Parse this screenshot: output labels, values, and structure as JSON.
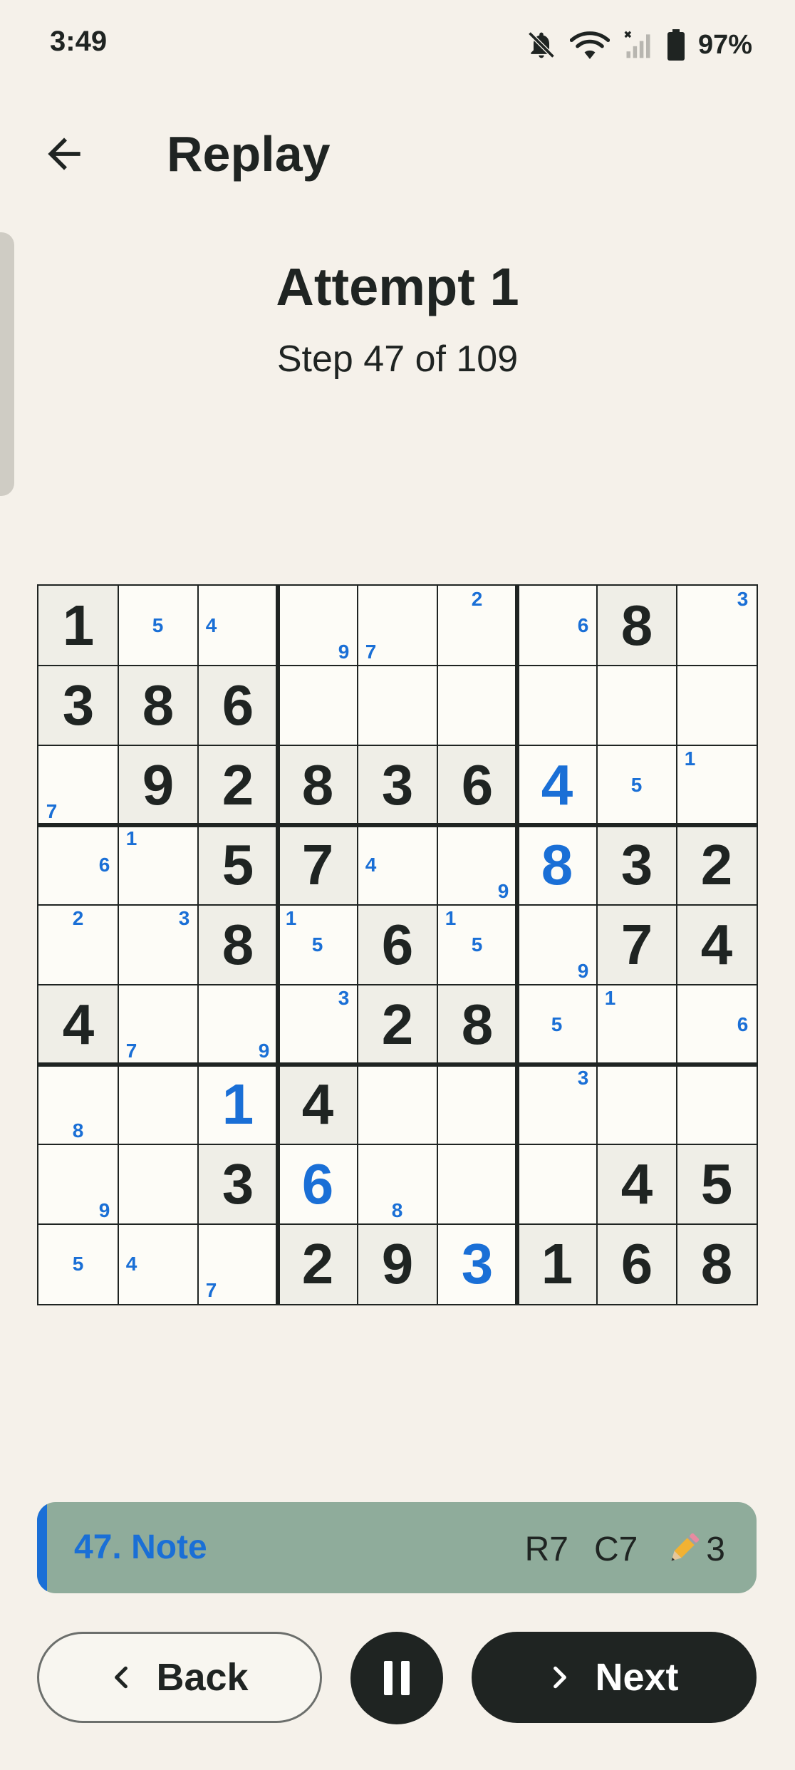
{
  "status_bar": {
    "time": "3:49",
    "battery": "97%",
    "icons": [
      "bell-off-icon",
      "wifi-icon",
      "signal-off-icon",
      "battery-icon"
    ]
  },
  "header": {
    "title": "Replay",
    "back_icon": "arrow-left-icon"
  },
  "replay": {
    "attempt": "Attempt 1",
    "step": "Step 47 of 109",
    "current_step": 47,
    "total_steps": 109
  },
  "board": {
    "given": [
      "1000000080",
      "386000000",
      "092836000",
      "005700032",
      "008060074",
      "400028000",
      "000400000",
      "003000045",
      "000290168"
    ],
    "user": [
      "000000000",
      "000000000",
      "000000400",
      "000000800",
      "000000000",
      "000000000",
      "001000000",
      "000600000",
      "000003000"
    ],
    "notes": [
      [
        [],
        [
          5
        ],
        [
          4
        ],
        [
          9
        ],
        [
          7
        ],
        [
          2
        ],
        [
          6
        ],
        [],
        [
          3
        ]
      ],
      [
        [],
        [],
        [],
        [],
        [],
        [],
        [],
        [],
        []
      ],
      [
        [
          7
        ],
        [],
        [],
        [],
        [],
        [],
        [],
        [
          5
        ],
        [
          1
        ]
      ],
      [
        [
          6
        ],
        [
          1
        ],
        [],
        [],
        [
          4
        ],
        [
          9
        ],
        [],
        [],
        []
      ],
      [
        [
          2
        ],
        [
          3
        ],
        [],
        [
          1,
          5
        ],
        [],
        [
          1,
          5
        ],
        [
          9
        ],
        [],
        []
      ],
      [
        [],
        [
          7
        ],
        [
          9
        ],
        [
          3
        ],
        [],
        [],
        [
          5
        ],
        [
          1
        ],
        [
          6
        ]
      ],
      [
        [
          8
        ],
        [],
        [],
        [],
        [],
        [],
        [
          3
        ],
        [],
        []
      ],
      [
        [
          9
        ],
        [],
        [],
        [],
        [
          8
        ],
        [],
        [],
        [],
        []
      ],
      [
        [
          5
        ],
        [
          4
        ],
        [
          7
        ],
        [],
        [],
        [],
        [],
        [],
        []
      ]
    ],
    "colors": {
      "given": "#1f2422",
      "user": "#1a6fd6",
      "note": "#1a6fd6",
      "given_bg": "#efeee7",
      "cell_bg": "#fdfcf7"
    }
  },
  "log": {
    "label": "47. Note",
    "row": "R7",
    "col": "C7",
    "note_icon": "pencil-icon",
    "note_value": "3",
    "bg_color": "#8fac9b",
    "accent_color": "#1a6fd6"
  },
  "controls": {
    "back_label": "Back",
    "next_label": "Next",
    "pause_icon": "pause-icon"
  }
}
